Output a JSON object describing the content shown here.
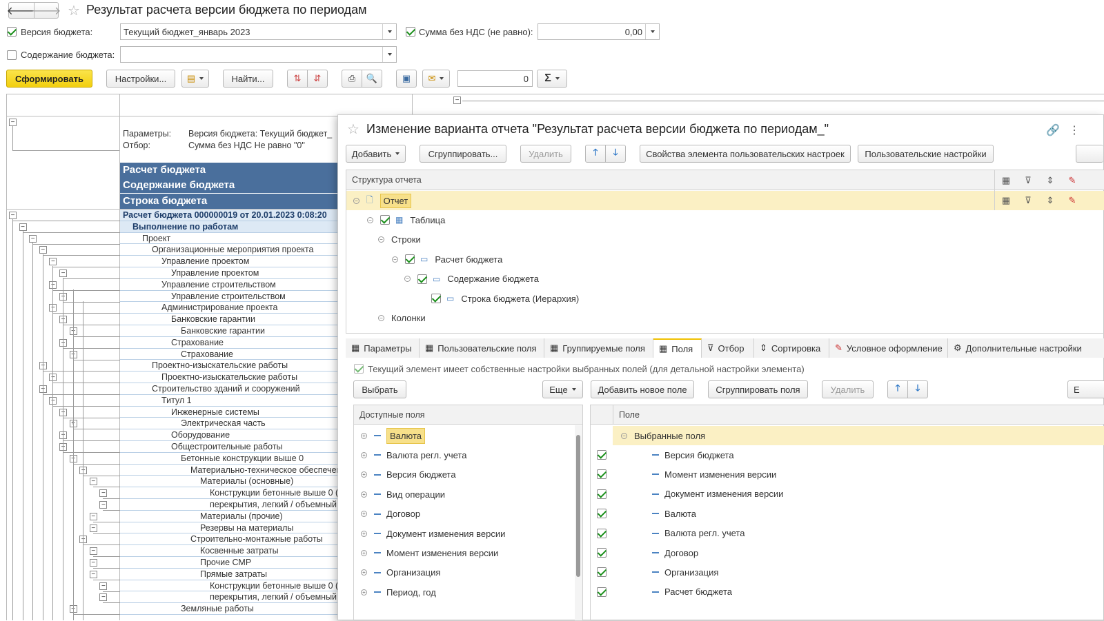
{
  "window": {
    "title": "Результат расчета версии бюджета по периодам"
  },
  "filters": {
    "version_label": "Версия бюджета:",
    "version_value": "Текущий бюджет_январь 2023",
    "sum_label": "Сумма без НДС (не равно):",
    "sum_value": "0,00",
    "content_label": "Содержание бюджета:",
    "content_value": ""
  },
  "toolbar": {
    "generate": "Сформировать",
    "settings": "Настройки...",
    "find": "Найти...",
    "counter": "0",
    "sigma": "Σ"
  },
  "report": {
    "params_label": "Параметры:",
    "params_value": "Версия бюджета: Текущий бюджет_",
    "filter_label": "Отбор:",
    "filter_value": "Сумма без НДС Не равно \"0\"",
    "headers": [
      "Расчет бюджета",
      "Содержание бюджета",
      "Строка бюджета"
    ],
    "rows": [
      {
        "text": "Расчет бюджета 000000019 от 20.01.2023 0:08:20",
        "ind": 0,
        "b": 1
      },
      {
        "text": "Выполнение по работам",
        "ind": 14,
        "b": 1
      },
      {
        "text": "Проект",
        "ind": 28
      },
      {
        "text": "Организационные мероприятия проекта",
        "ind": 42
      },
      {
        "text": "Управление проектом",
        "ind": 56
      },
      {
        "text": "Управление проектом",
        "ind": 70
      },
      {
        "text": "Управление строительством",
        "ind": 56
      },
      {
        "text": "Управление строительством",
        "ind": 70
      },
      {
        "text": "Администрирование проекта",
        "ind": 56
      },
      {
        "text": "Банковские гарантии",
        "ind": 70
      },
      {
        "text": "Банковские гарантии",
        "ind": 84
      },
      {
        "text": "Страхование",
        "ind": 70
      },
      {
        "text": "Страхование",
        "ind": 84
      },
      {
        "text": "Проектно-изыскательские работы",
        "ind": 42
      },
      {
        "text": "Проектно-изыскательские работы",
        "ind": 56
      },
      {
        "text": "Строительство зданий и сооружений",
        "ind": 42
      },
      {
        "text": "Титул 1",
        "ind": 56
      },
      {
        "text": "Инженерные системы",
        "ind": 70
      },
      {
        "text": "Электрическая часть",
        "ind": 84
      },
      {
        "text": "Оборудование",
        "ind": 70
      },
      {
        "text": "Общестроительные работы",
        "ind": 70
      },
      {
        "text": "Бетонные конструкции выше 0",
        "ind": 84
      },
      {
        "text": "Материально-техническое обеспечен",
        "ind": 98
      },
      {
        "text": "Материалы (основные)",
        "ind": 112
      },
      {
        "text": "Конструкции бетонные выше 0 (",
        "ind": 126
      },
      {
        "text": "перекрытия, легкий / объемный",
        "ind": 126
      },
      {
        "text": "Материалы (прочие)",
        "ind": 112
      },
      {
        "text": "Резервы на материалы",
        "ind": 112
      },
      {
        "text": "Строительно-монтажные работы",
        "ind": 98
      },
      {
        "text": "Косвенные затраты",
        "ind": 112
      },
      {
        "text": "Прочие СМР",
        "ind": 112
      },
      {
        "text": "Прямые затраты",
        "ind": 112
      },
      {
        "text": "Конструкции бетонные выше 0 (",
        "ind": 126
      },
      {
        "text": "перекрытия, легкий / объемный",
        "ind": 126
      },
      {
        "text": "Земляные работы",
        "ind": 84
      }
    ]
  },
  "dialog": {
    "title": "Изменение варианта отчета \"Результат расчета версии бюджета по периодам_\"",
    "add": "Добавить",
    "group": "Сгруппировать...",
    "delete": "Удалить",
    "props": "Свойства элемента пользовательских настроек",
    "user_settings": "Пользовательские настройки",
    "structure_header": "Структура отчета",
    "structure": [
      {
        "text": "Отчет",
        "ind": 0,
        "sel": true,
        "icon": "doc"
      },
      {
        "text": "Таблица",
        "ind": 20,
        "chk": true,
        "icon": "table"
      },
      {
        "text": "Строки",
        "ind": 36
      },
      {
        "text": "Расчет бюджета",
        "ind": 56,
        "chk": true,
        "icon": "group"
      },
      {
        "text": "Содержание бюджета",
        "ind": 74,
        "chk": true,
        "icon": "group"
      },
      {
        "text": "Строка бюджета (Иерархия)",
        "ind": 92,
        "chk": true,
        "icon": "group"
      },
      {
        "text": "Колонки",
        "ind": 36
      }
    ],
    "tabs": [
      "Параметры",
      "Пользовательские поля",
      "Группируемые поля",
      "Поля",
      "Отбор",
      "Сортировка",
      "Условное оформление",
      "Дополнительные настройки"
    ],
    "own_settings": "Текущий элемент имеет собственные настройки выбранных полей (для детальной настройки элемента)",
    "choose": "Выбрать",
    "more": "Еще",
    "add_field": "Добавить новое поле",
    "group_fields": "Сгруппировать поля",
    "delete_field": "Удалить",
    "available_header": "Доступные поля",
    "available": [
      "Валюта",
      "Валюта регл. учета",
      "Версия бюджета",
      "Вид операции",
      "Договор",
      "Документ изменения версии",
      "Момент изменения версии",
      "Организация",
      "Период, год"
    ],
    "selected_header": "Поле",
    "selected_root": "Выбранные поля",
    "selected": [
      "Версия бюджета",
      "Момент изменения версии",
      "Документ изменения версии",
      "Валюта",
      "Валюта регл. учета",
      "Договор",
      "Организация",
      "Расчет бюджета"
    ]
  }
}
